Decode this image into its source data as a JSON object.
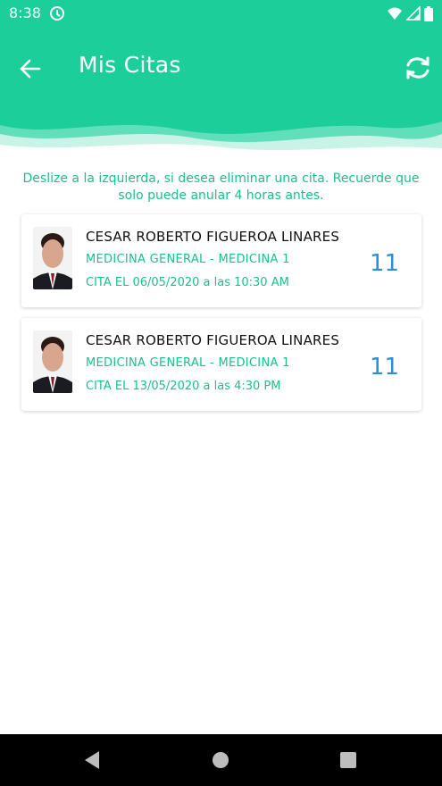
{
  "status_bar": {
    "time": "8:38",
    "icons": [
      "at-sign-icon",
      "wifi-icon",
      "signal-icon",
      "battery-icon"
    ]
  },
  "header": {
    "title": "Mis Citas",
    "back_icon": "arrow-left-icon",
    "refresh_icon": "refresh-icon",
    "color": "#1ccf9a"
  },
  "instructions": "Deslize a la izquierda, si desea eliminar una cita. Recuerde que solo puede anular 4 horas antes.",
  "appointments": [
    {
      "doctor": "CESAR ROBERTO FIGUEROA LINARES",
      "specialty": "MEDICINA GENERAL - MEDICINA 1",
      "datetime": "CITA EL 06/05/2020 a las 10:30 AM",
      "number": "11"
    },
    {
      "doctor": "CESAR ROBERTO FIGUEROA LINARES",
      "specialty": "MEDICINA GENERAL - MEDICINA 1",
      "datetime": "CITA EL 13/05/2020 a las 4:30 PM",
      "number": "11"
    }
  ],
  "colors": {
    "accent": "#1ccf9a",
    "text_accent": "#1bbf8d",
    "number": "#2a8fd6"
  }
}
